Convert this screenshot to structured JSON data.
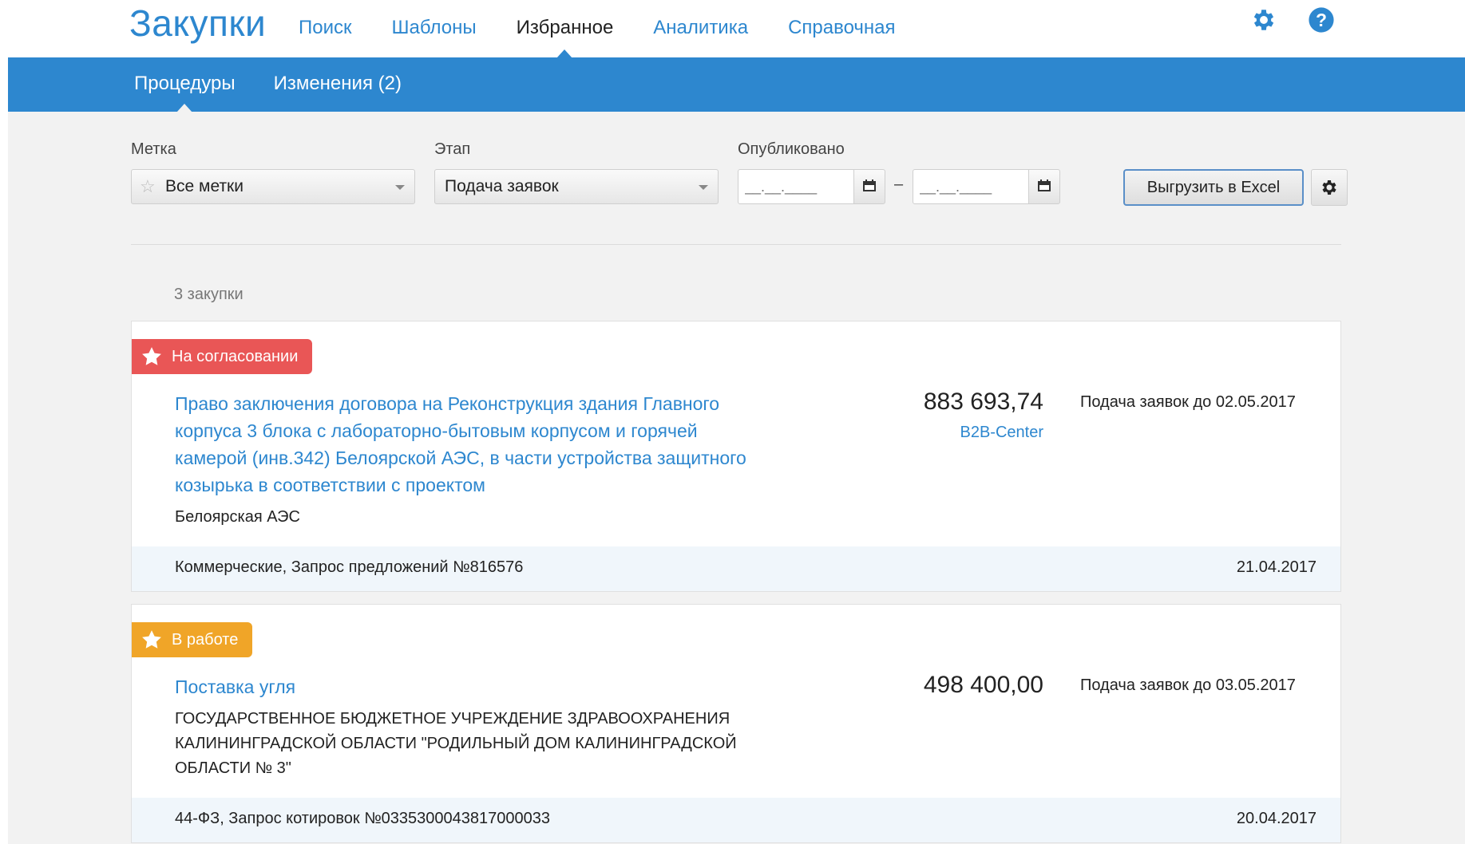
{
  "header": {
    "logo": "Закупки",
    "nav": [
      {
        "label": "Поиск",
        "active": false
      },
      {
        "label": "Шаблоны",
        "active": false
      },
      {
        "label": "Избранное",
        "active": true
      },
      {
        "label": "Аналитика",
        "active": false
      },
      {
        "label": "Справочная",
        "active": false
      }
    ],
    "icons": [
      "gear-icon",
      "help-icon"
    ]
  },
  "subnav": {
    "tabs": [
      {
        "label": "Процедуры",
        "active": true
      },
      {
        "label": "Изменения (2)",
        "active": false
      }
    ]
  },
  "filters": {
    "tag_label": "Метка",
    "tag_value": "Все метки",
    "stage_label": "Этап",
    "stage_value": "Подача заявок",
    "published_label": "Опубликовано",
    "date_from_placeholder": "__.__.____",
    "date_to_placeholder": "__.__.____",
    "range_dash": "–",
    "export_label": "Выгрузить в Excel"
  },
  "results": {
    "count": "3 закупки",
    "items": [
      {
        "badge": "На согласовании",
        "badge_color": "#e95656",
        "title_lines": [
          "Право заключения договора на Реконструкция здания Главного",
          "корпуса 3 блока с лабораторно-бытовым корпусом и горячей",
          "камерой (инв.342) Белоярской АЭС, в части устройства защитного",
          "козырька в соответствии с проектом"
        ],
        "org": "Белоярская АЭС",
        "price": "883 693,74",
        "source": "B2B-Center",
        "deadline": "Подача заявок до 02.05.2017",
        "type": "Коммерческие, Запрос предложений №816576",
        "date": "21.04.2017"
      },
      {
        "badge": "В работе",
        "badge_color": "#f0a528",
        "title_lines": [
          "Поставка угля"
        ],
        "org_lines": [
          "ГОСУДАРСТВЕННОЕ БЮДЖЕТНОЕ УЧРЕЖДЕНИЕ ЗДРАВООХРАНЕНИЯ",
          "КАЛИНИНГРАДСКОЙ ОБЛАСТИ \"РОДИЛЬНЫЙ ДОМ КАЛИНИНГРАДСКОЙ",
          "ОБЛАСТИ № 3\""
        ],
        "price": "498 400,00",
        "deadline": "Подача заявок до 03.05.2017",
        "type": "44-ФЗ, Запрос котировок №0335300043817000033",
        "date": "20.04.2017"
      }
    ]
  }
}
